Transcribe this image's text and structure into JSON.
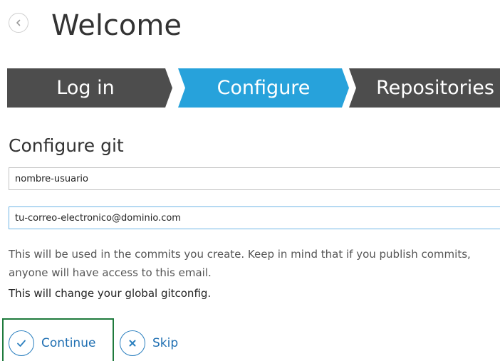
{
  "header": {
    "title": "Welcome",
    "back_icon": "chevron-left-icon"
  },
  "steps": [
    {
      "label": "Log in",
      "state": "done",
      "color": "#4d4d4d"
    },
    {
      "label": "Configure",
      "state": "active",
      "color": "#27a2db"
    },
    {
      "label": "Repositories",
      "state": "pending",
      "color": "#4d4d4d"
    }
  ],
  "form": {
    "section_title": "Configure git",
    "name_value": "nombre-usuario",
    "email_value": "tu-correo-electronico@dominio.com",
    "hint": "This will be used in the commits you create. Keep in mind that if you publish commits, anyone will have access to this email.",
    "global_notice": "This will change your global gitconfig."
  },
  "actions": {
    "continue_label": "Continue",
    "continue_icon": "checkmark-icon",
    "skip_label": "Skip",
    "skip_icon": "close-icon",
    "accent_color": "#1f6fb2",
    "highlight_color": "#1e7a3c"
  }
}
